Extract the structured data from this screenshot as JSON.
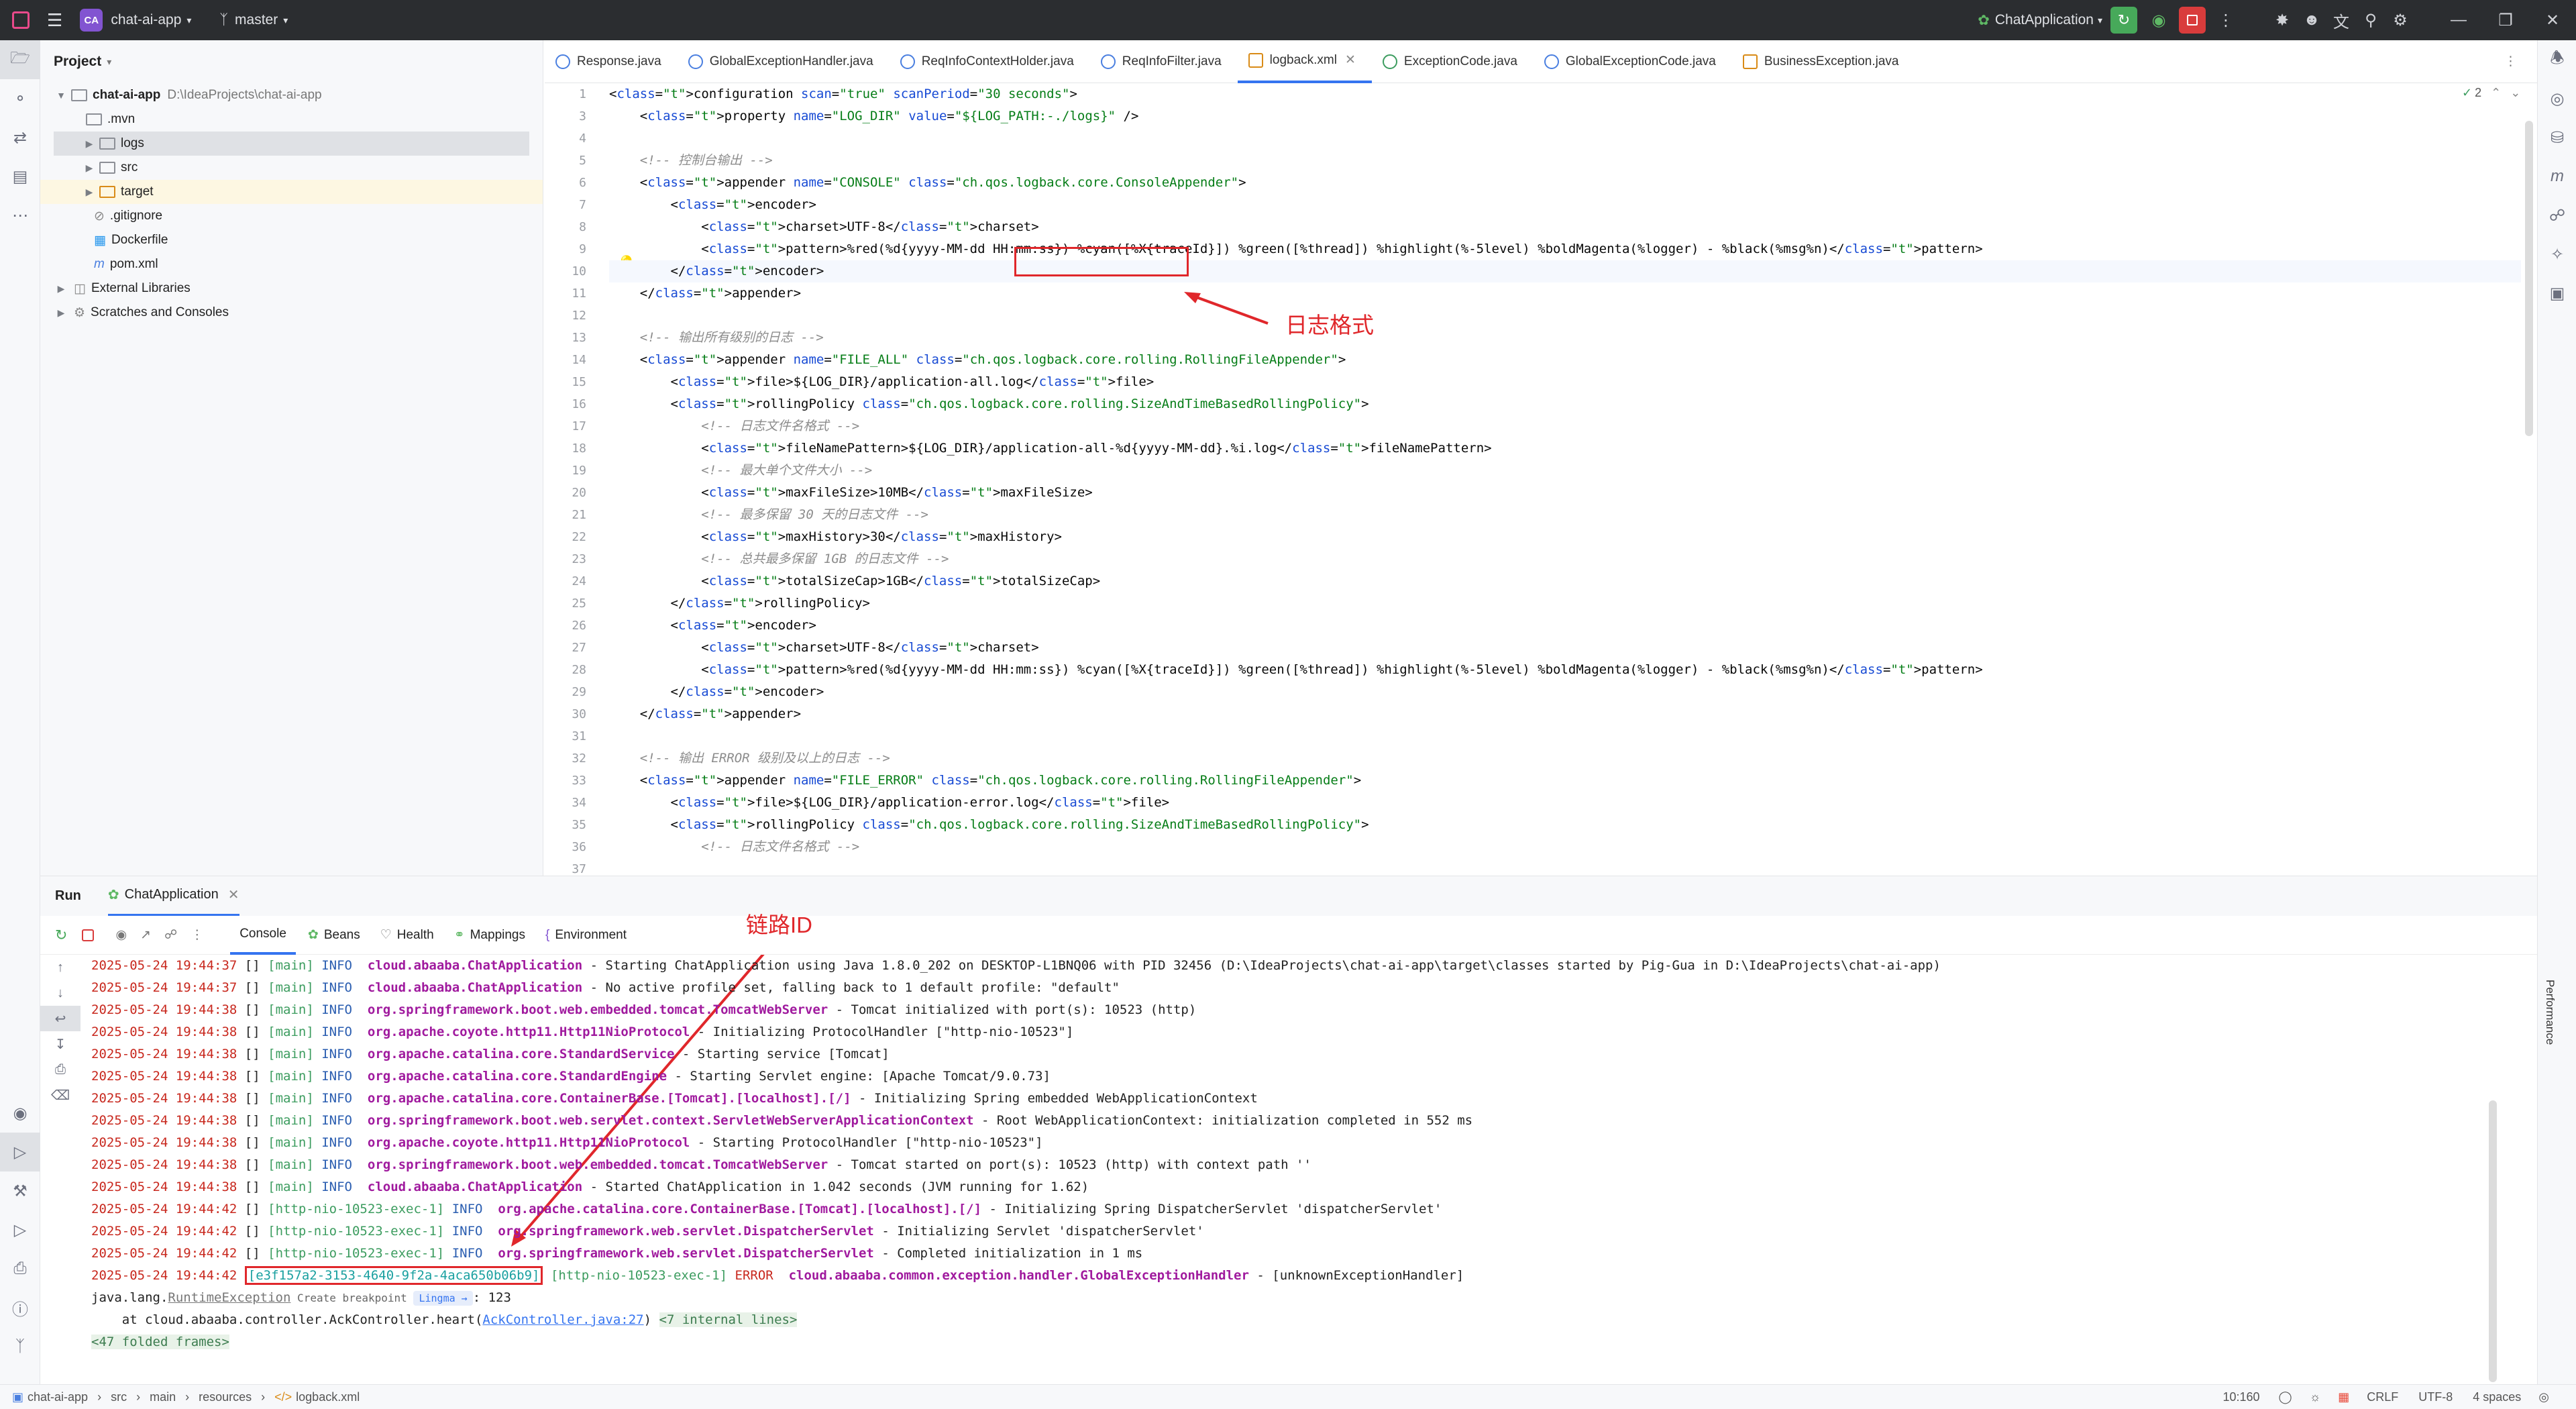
{
  "titlebar": {
    "project_badge": "CA",
    "project_name": "chat-ai-app",
    "branch": "master",
    "run_config": "ChatApplication"
  },
  "project_panel": {
    "title": "Project",
    "items": [
      {
        "label": "chat-ai-app",
        "path": "D:\\IdeaProjects\\chat-ai-app"
      },
      {
        "label": ".mvn"
      },
      {
        "label": "logs"
      },
      {
        "label": "src"
      },
      {
        "label": "target"
      },
      {
        "label": ".gitignore"
      },
      {
        "label": "Dockerfile"
      },
      {
        "label": "pom.xml"
      },
      {
        "label": "External Libraries"
      },
      {
        "label": "Scratches and Consoles"
      }
    ]
  },
  "tabs": [
    "Response.java",
    "GlobalExceptionHandler.java",
    "ReqInfoContextHolder.java",
    "ReqInfoFilter.java",
    "logback.xml",
    "ExceptionCode.java",
    "GlobalExceptionCode.java",
    "BusinessException.java"
  ],
  "editor": {
    "inspection_count": "2",
    "line_numbers": [
      "1",
      "3",
      "4",
      "5",
      "6",
      "7",
      "8",
      "9",
      "10",
      "11",
      "12",
      "13",
      "14",
      "15",
      "16",
      "17",
      "18",
      "19",
      "20",
      "21",
      "22",
      "23",
      "24",
      "25",
      "26",
      "27",
      "28",
      "29",
      "30",
      "31",
      "32",
      "33",
      "34",
      "35",
      "36",
      "37"
    ],
    "lines": [
      "<configuration scan=\"true\" scanPeriod=\"30 seconds\">",
      "    <property name=\"LOG_DIR\" value=\"${LOG_PATH:-./logs}\" />",
      "",
      "    <!-- 控制台输出 -->",
      "    <appender name=\"CONSOLE\" class=\"ch.qos.logback.core.ConsoleAppender\">",
      "        <encoder>",
      "            <charset>UTF-8</charset>",
      "            <pattern>%red(%d{yyyy-MM-dd HH:mm:ss}) %cyan([%X{traceId}]) %green([%thread]) %highlight(%-5level) %boldMagenta(%logger) - %black(%msg%n)</pattern>",
      "        </encoder>",
      "    </appender>",
      "",
      "    <!-- 输出所有级别的日志 -->",
      "    <appender name=\"FILE_ALL\" class=\"ch.qos.logback.core.rolling.RollingFileAppender\">",
      "        <file>${LOG_DIR}/application-all.log</file>",
      "        <rollingPolicy class=\"ch.qos.logback.core.rolling.SizeAndTimeBasedRollingPolicy\">",
      "            <!-- 日志文件名格式 -->",
      "            <fileNamePattern>${LOG_DIR}/application-all-%d{yyyy-MM-dd}.%i.log</fileNamePattern>",
      "            <!-- 最大单个文件大小 -->",
      "            <maxFileSize>10MB</maxFileSize>",
      "            <!-- 最多保留 30 天的日志文件 -->",
      "            <maxHistory>30</maxHistory>",
      "            <!-- 总共最多保留 1GB 的日志文件 -->",
      "            <totalSizeCap>1GB</totalSizeCap>",
      "        </rollingPolicy>",
      "        <encoder>",
      "            <charset>UTF-8</charset>",
      "            <pattern>%red(%d{yyyy-MM-dd HH:mm:ss}) %cyan([%X{traceId}]) %green([%thread]) %highlight(%-5level) %boldMagenta(%logger) - %black(%msg%n)</pattern>",
      "        </encoder>",
      "    </appender>",
      "",
      "    <!-- 输出 ERROR 级别及以上的日志 -->",
      "    <appender name=\"FILE_ERROR\" class=\"ch.qos.logback.core.rolling.RollingFileAppender\">",
      "        <file>${LOG_DIR}/application-error.log</file>",
      "        <rollingPolicy class=\"ch.qos.logback.core.rolling.SizeAndTimeBasedRollingPolicy\">",
      "            <!-- 日志文件名格式 -->"
    ]
  },
  "annotations": {
    "log_format": "日志格式",
    "trace_id": "链路ID"
  },
  "run_panel": {
    "title": "Run",
    "config_tab": "ChatApplication",
    "tabs": [
      "Console",
      "Beans",
      "Health",
      "Mappings",
      "Environment"
    ],
    "side_label": "Performance"
  },
  "console": {
    "lines": [
      {
        "ts": "2025-05-24 19:44:37",
        "tid": "[]",
        "thread": "[main]",
        "level": "INFO",
        "logger": "cloud.abaaba.ChatApplication",
        "msg": " - Starting ChatApplication using Java 1.8.0_202 on DESKTOP-L1BNQ06 with PID 32456 (D:\\IdeaProjects\\chat-ai-app\\target\\classes started by Pig-Gua in D:\\IdeaProjects\\chat-ai-app)"
      },
      {
        "ts": "2025-05-24 19:44:37",
        "tid": "[]",
        "thread": "[main]",
        "level": "INFO",
        "logger": "cloud.abaaba.ChatApplication",
        "msg": " - No active profile set, falling back to 1 default profile: \"default\""
      },
      {
        "ts": "2025-05-24 19:44:38",
        "tid": "[]",
        "thread": "[main]",
        "level": "INFO",
        "logger": "org.springframework.boot.web.embedded.tomcat.TomcatWebServer",
        "msg": " - Tomcat initialized with port(s): 10523 (http)"
      },
      {
        "ts": "2025-05-24 19:44:38",
        "tid": "[]",
        "thread": "[main]",
        "level": "INFO",
        "logger": "org.apache.coyote.http11.Http11NioProtocol",
        "msg": " - Initializing ProtocolHandler [\"http-nio-10523\"]"
      },
      {
        "ts": "2025-05-24 19:44:38",
        "tid": "[]",
        "thread": "[main]",
        "level": "INFO",
        "logger": "org.apache.catalina.core.StandardService",
        "msg": " - Starting service [Tomcat]"
      },
      {
        "ts": "2025-05-24 19:44:38",
        "tid": "[]",
        "thread": "[main]",
        "level": "INFO",
        "logger": "org.apache.catalina.core.StandardEngine",
        "msg": " - Starting Servlet engine: [Apache Tomcat/9.0.73]"
      },
      {
        "ts": "2025-05-24 19:44:38",
        "tid": "[]",
        "thread": "[main]",
        "level": "INFO",
        "logger": "org.apache.catalina.core.ContainerBase.[Tomcat].[localhost].[/]",
        "msg": " - Initializing Spring embedded WebApplicationContext"
      },
      {
        "ts": "2025-05-24 19:44:38",
        "tid": "[]",
        "thread": "[main]",
        "level": "INFO",
        "logger": "org.springframework.boot.web.servlet.context.ServletWebServerApplicationContext",
        "msg": " - Root WebApplicationContext: initialization completed in 552 ms"
      },
      {
        "ts": "2025-05-24 19:44:38",
        "tid": "[]",
        "thread": "[main]",
        "level": "INFO",
        "logger": "org.apache.coyote.http11.Http11NioProtocol",
        "msg": " - Starting ProtocolHandler [\"http-nio-10523\"]"
      },
      {
        "ts": "2025-05-24 19:44:38",
        "tid": "[]",
        "thread": "[main]",
        "level": "INFO",
        "logger": "org.springframework.boot.web.embedded.tomcat.TomcatWebServer",
        "msg": " - Tomcat started on port(s): 10523 (http) with context path ''"
      },
      {
        "ts": "2025-05-24 19:44:38",
        "tid": "[]",
        "thread": "[main]",
        "level": "INFO",
        "logger": "cloud.abaaba.ChatApplication",
        "msg": " - Started ChatApplication in 1.042 seconds (JVM running for 1.62)"
      },
      {
        "ts": "2025-05-24 19:44:42",
        "tid": "[]",
        "thread": "[http-nio-10523-exec-1]",
        "level": "INFO",
        "logger": "org.apache.catalina.core.ContainerBase.[Tomcat].[localhost].[/]",
        "msg": " - Initializing Spring DispatcherServlet 'dispatcherServlet'"
      },
      {
        "ts": "2025-05-24 19:44:42",
        "tid": "[]",
        "thread": "[http-nio-10523-exec-1]",
        "level": "INFO",
        "logger": "org.springframework.web.servlet.DispatcherServlet",
        "msg": " - Initializing Servlet 'dispatcherServlet'"
      },
      {
        "ts": "2025-05-24 19:44:42",
        "tid": "[]",
        "thread": "[http-nio-10523-exec-1]",
        "level": "INFO",
        "logger": "org.springframework.web.servlet.DispatcherServlet",
        "msg": " - Completed initialization in 1 ms"
      },
      {
        "ts": "2025-05-24 19:44:42",
        "tid": "[e3f157a2-3153-4640-9f2a-4aca650b06b9]",
        "thread": "[http-nio-10523-exec-1]",
        "level": "ERROR",
        "logger": "cloud.abaaba.common.exception.handler.GlobalExceptionHandler",
        "msg": " - [unknownExceptionHandler]"
      }
    ],
    "exception": {
      "prefix": "java.lang.",
      "name": "RuntimeException",
      "breakpoint": "Create breakpoint",
      "lingma": "Lingma",
      "suffix": ": 123"
    },
    "stack": {
      "prefix": "    at cloud.abaaba.controller.AckController.heart(",
      "link": "AckController.java:27",
      "close": ")",
      "internal": "<7 internal lines>"
    },
    "folded": "<47 folded frames>"
  },
  "statusbar": {
    "breadcrumb": [
      "chat-ai-app",
      "src",
      "main",
      "resources",
      "logback.xml"
    ],
    "position": "10:160",
    "line_sep": "CRLF",
    "encoding": "UTF-8",
    "indent": "4 spaces"
  }
}
